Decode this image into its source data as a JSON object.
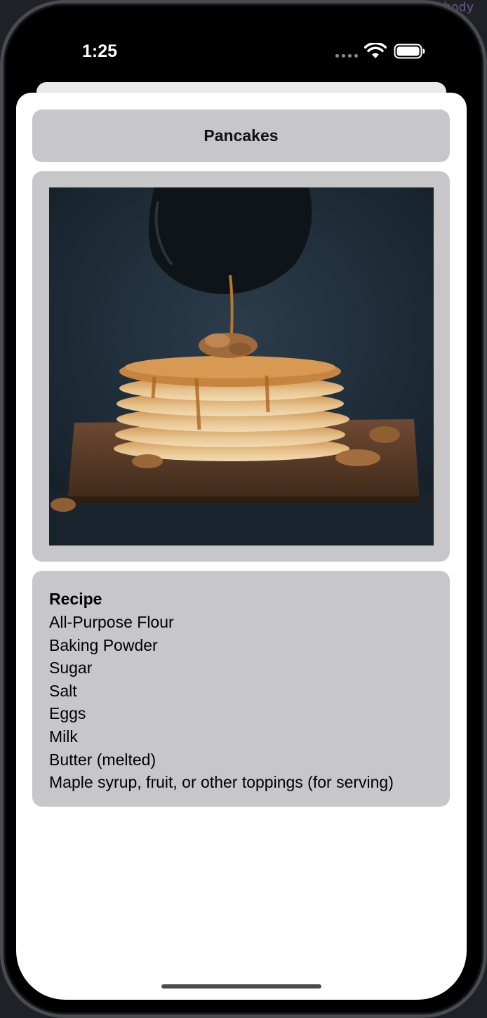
{
  "status_bar": {
    "time": "1:25"
  },
  "background_editor": {
    "fragment_top_right": "body"
  },
  "detail": {
    "title": "Pancakes",
    "image": {
      "icon": "pancake-stack-photo"
    },
    "recipe": {
      "heading": "Recipe",
      "ingredients": [
        "All-Purpose Flour",
        "Baking Powder",
        "Sugar",
        "Salt",
        "Eggs",
        "Milk",
        "Butter (melted)",
        "Maple syrup, fruit, or other toppings (for serving)"
      ]
    }
  },
  "colors": {
    "card_background": "#c7c7c9",
    "sheet_background": "#ffffff",
    "photo_background": "#1c2a36"
  }
}
